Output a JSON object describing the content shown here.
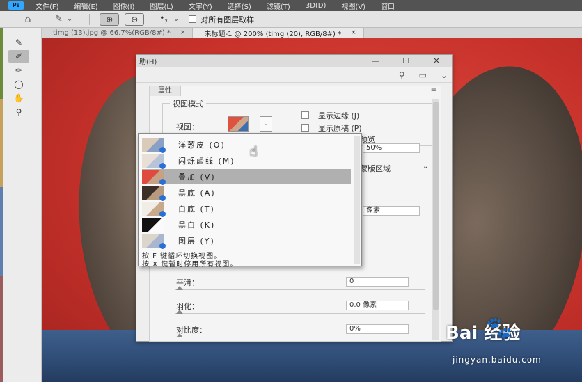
{
  "app": {
    "logo": "Ps"
  },
  "menubar": [
    "文件(F)",
    "编辑(E)",
    "图像(I)",
    "图层(L)",
    "文字(Y)",
    "选择(S)",
    "滤镜(T)",
    "3D(D)",
    "视图(V)",
    "窗口"
  ],
  "options": {
    "brush_size": "7",
    "checkbox_label": "对所有图层取样",
    "icons": [
      "home-icon",
      "quick-select-icon",
      "add-mode-icon",
      "subtract-mode-icon",
      "brush-preset-icon"
    ]
  },
  "tabs": [
    {
      "label": "timg (13).jpg @ 66.7%(RGB/8#) *",
      "close": "×"
    },
    {
      "label": "未标题-1 @ 200% (timg (20), RGB/8#) *",
      "close": "×"
    }
  ],
  "properties_window": {
    "title": "助(H)",
    "window_buttons": [
      "—",
      "☐",
      "✕"
    ],
    "panel_tab": "属性",
    "panel_menu": "≡",
    "view_mode_group": "视图模式",
    "view_label": "视图：",
    "show_edge": "显示边缘 (J)",
    "show_original": "显示原稿 (P)",
    "hq_preview_partial": "预览",
    "opacity_value": "50%",
    "region_partial": "蒙版区域",
    "radius_partial": "像素",
    "smooth_label": "平滑：",
    "smooth_value": "0",
    "feather_label": "羽化：",
    "feather_value": "0.0 像素",
    "contrast_label": "对比度：",
    "contrast_value": "0%"
  },
  "view_menu": {
    "items": [
      {
        "label": "洋葱皮 (O)",
        "selected": false
      },
      {
        "label": "闪烁虚线 (M)",
        "selected": false
      },
      {
        "label": "叠加 (V)",
        "selected": true
      },
      {
        "label": "黑底 (A)",
        "selected": false
      },
      {
        "label": "白底 (T)",
        "selected": false
      },
      {
        "label": "黑白 (K)",
        "selected": false
      },
      {
        "label": "图层 (Y)",
        "selected": false
      }
    ],
    "hint1": "按 F 键循环切换视图。",
    "hint2": "按 X 键暂时停用所有视图。"
  },
  "watermark": {
    "brand": "Bai  经验",
    "paw": "🐾",
    "url": "jingyan.baidu.com"
  },
  "colors": {
    "menubar": "#535353",
    "selected_item": "#b0b0b0",
    "background_red": "#c7322b"
  }
}
